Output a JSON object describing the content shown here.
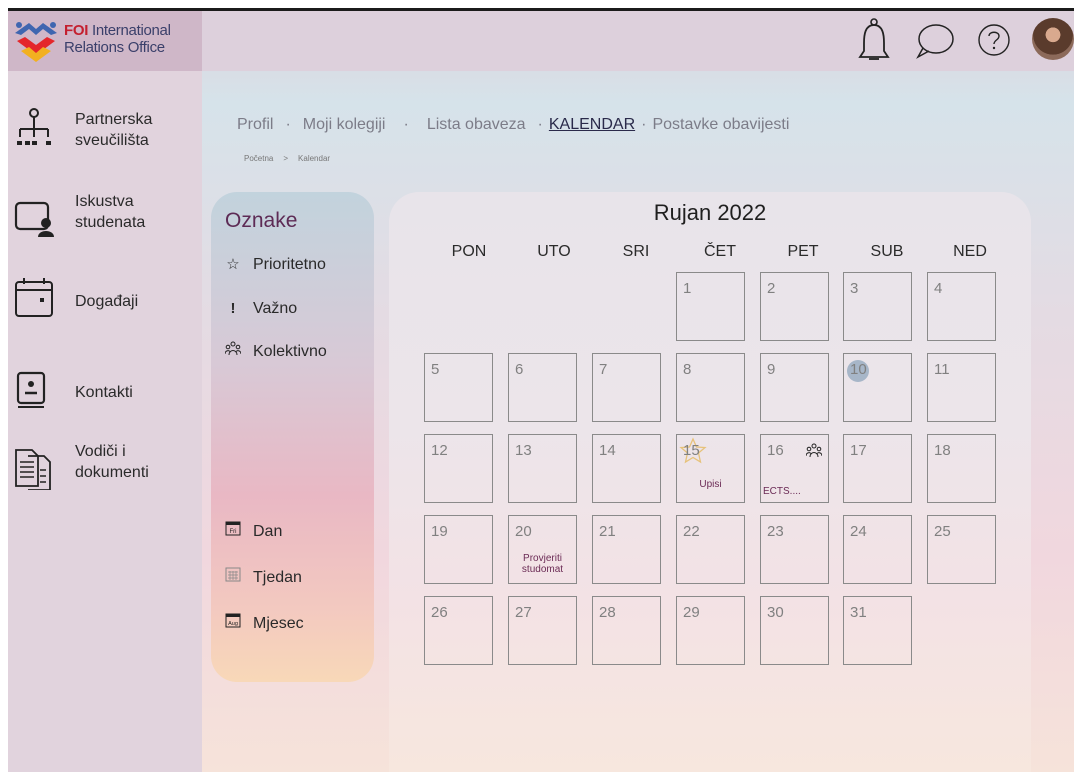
{
  "header": {
    "logo_line1_brand": "FOI",
    "logo_line1_rest": " International",
    "logo_line2": "Relations Office",
    "icons": [
      "bell-icon",
      "chat-bubble-icon",
      "help-icon",
      "avatar"
    ]
  },
  "sidebar": {
    "items": [
      {
        "label": "Partnerska sveučilišta",
        "icon": "org-chart-icon"
      },
      {
        "label": "Iskustva studenata",
        "icon": "student-screen-icon"
      },
      {
        "label": "Događaji",
        "icon": "calendar-icon"
      },
      {
        "label": "Kontakti",
        "icon": "contact-book-icon"
      },
      {
        "label": "Vodiči i dokumenti",
        "icon": "documents-icon"
      }
    ]
  },
  "tabs": [
    {
      "label": "Profil"
    },
    {
      "label": "Moji kolegiji"
    },
    {
      "label": "Lista obaveza"
    },
    {
      "label": "KALENDAR"
    },
    {
      "label": "Postavke obavijesti"
    }
  ],
  "tab_separator": "·",
  "breadcrumb": {
    "home": "Početna",
    "separator": ">",
    "current": "Kalendar"
  },
  "labels_panel": {
    "title": "Oznake",
    "tags": [
      {
        "label": "Prioritetno",
        "icon": "star-icon"
      },
      {
        "label": "Važno",
        "icon": "exclamation-icon"
      },
      {
        "label": "Kolektivno",
        "icon": "group-icon"
      }
    ],
    "views": [
      {
        "label": "Dan",
        "icon": "day-view-icon",
        "icon_text": "Fri"
      },
      {
        "label": "Tjedan",
        "icon": "week-view-icon"
      },
      {
        "label": "Mjesec",
        "icon": "month-view-icon",
        "icon_text": "Aug"
      }
    ]
  },
  "calendar": {
    "title": "Rujan 2022",
    "weekdays": [
      "PON",
      "UTO",
      "SRI",
      "ČET",
      "PET",
      "SUB",
      "NED"
    ],
    "days": [
      "1",
      "2",
      "3",
      "4",
      "5",
      "6",
      "7",
      "8",
      "9",
      "10",
      "11",
      "12",
      "13",
      "14",
      "15",
      "16",
      "17",
      "18",
      "19",
      "20",
      "21",
      "22",
      "23",
      "24",
      "25",
      "26",
      "27",
      "28",
      "29",
      "30",
      "31"
    ],
    "today": "10",
    "events": {
      "15": "Upisi",
      "16": "ECTS....",
      "20": "Provjeriti studomat"
    },
    "colors": {
      "today": "#a7b6c8",
      "note": "#6b2b55",
      "accent": "#5d2b55"
    }
  }
}
